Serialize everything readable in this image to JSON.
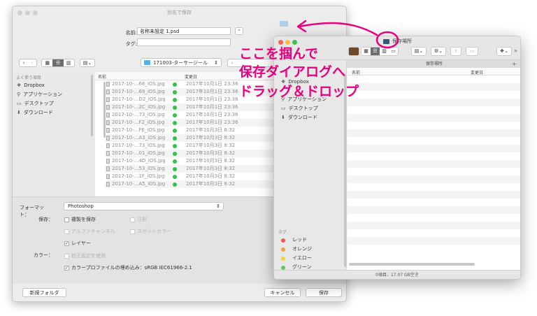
{
  "save_dialog": {
    "title": "別名で保存",
    "name_label": "名前:",
    "name_value": "名称未設定 1.psd",
    "tags_label": "タグ:",
    "tags_value": "",
    "location": "171003-ターサージール",
    "sidebar_header": "よく使う項目",
    "sidebar": [
      "Dropbox",
      "アプリケーション",
      "デスクトップ",
      "ダウンロード"
    ],
    "columns": {
      "name": "名前",
      "date": "変更日"
    },
    "files": [
      {
        "name": "2017-10-...68_iOS.jpg",
        "date": "2017年10月1日 23:36"
      },
      {
        "name": "2017-10-...69_iOS.jpg",
        "date": "2017年10月1日 23:36"
      },
      {
        "name": "2017-10-...D2_iOS.jpg",
        "date": "2017年10月1日 23:36"
      },
      {
        "name": "2017-10-...2C_iOS.jpg",
        "date": "2017年10月1日 23:36"
      },
      {
        "name": "2017-10-...73_iOS.jpg",
        "date": "2017年10月1日 23:36"
      },
      {
        "name": "2017-10-...F2_iOS.jpg",
        "date": "2017年10月1日 23:36"
      },
      {
        "name": "2017-10-...FE_iOS.jpg",
        "date": "2017年10月3日 8:32"
      },
      {
        "name": "2017-10-...A3_iOS.jpg",
        "date": "2017年10月3日 8:32"
      },
      {
        "name": "2017-10-...73_iOS.jpg",
        "date": "2017年10月3日 8:32"
      },
      {
        "name": "2017-10-...01_iOS.jpg",
        "date": "2017年10月3日 8:32"
      },
      {
        "name": "2017-10-...4D_iOS.jpg",
        "date": "2017年10月3日 8:32"
      },
      {
        "name": "2017-10-...53_iOS.jpg",
        "date": "2017年10月3日 8:32"
      },
      {
        "name": "2017-10-...1F_iOS.jpg",
        "date": "2017年10月3日 8:32"
      },
      {
        "name": "2017-10-...A5_iOS.jpg",
        "date": "2017年10月3日 8:32"
      }
    ],
    "format_label": "フォーマット：",
    "format_value": "Photoshop",
    "save_label": "保存：",
    "options": {
      "dup_save": "複製を保存",
      "notes": "注釈",
      "alpha": "アルファチャンネル",
      "spot": "スポットカラー",
      "layers": "レイヤー"
    },
    "color_label": "カラー：",
    "color_options": {
      "proof": "校正設定を使用",
      "profile": "カラープロファイルの埋め込み：sRGB IEC61966-2.1"
    },
    "new_folder": "新規フォルダ",
    "cancel": "キャンセル",
    "save": "保存"
  },
  "finder": {
    "title": "保存場所",
    "path_header": "保存場所",
    "columns": {
      "name": "名前",
      "date": "変更日"
    },
    "sidebar": [
      "Dropbox",
      "アプリケーション",
      "デスクトップ",
      "ダウンロード"
    ],
    "tags_header": "タグ",
    "tags": [
      {
        "label": "レッド",
        "color": "#f0584f"
      },
      {
        "label": "オレンジ",
        "color": "#f5a03a"
      },
      {
        "label": "イエロー",
        "color": "#f4cf3a"
      },
      {
        "label": "グリーン",
        "color": "#5dc95a"
      }
    ],
    "status": "0項目、17.07 GB空き"
  },
  "annotation": {
    "lines": [
      "ここを掴んで",
      "保存ダイアログへ",
      "ドラッグ＆ドロップ"
    ],
    "color": "#e6007e"
  }
}
